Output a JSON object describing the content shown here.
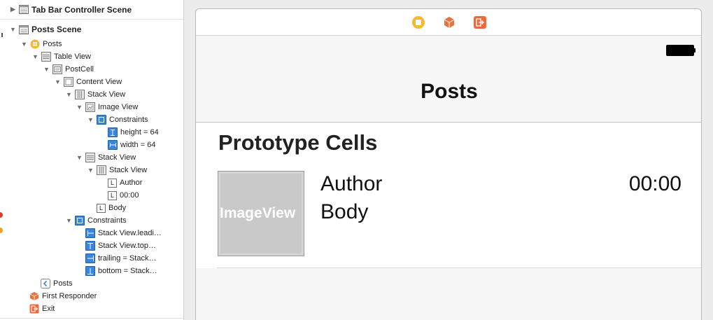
{
  "colors": {
    "accent_blue": "#3a86d8",
    "posts_yellow": "#f5b82e",
    "responder_orange": "#e8743b",
    "exit_orange": "#ef6a3a",
    "battery": "#000000"
  },
  "outline": {
    "tab_bar_scene": "Tab Bar Controller Scene",
    "posts_scene": "Posts Scene",
    "items": [
      {
        "label": "Posts",
        "icon": "view-controller-icon"
      },
      {
        "label": "Table View",
        "icon": "table-view-icon"
      },
      {
        "label": "PostCell",
        "icon": "table-cell-icon"
      },
      {
        "label": "Content View",
        "icon": "content-view-icon"
      },
      {
        "label": "Stack View",
        "icon": "horizontal-stack-icon"
      },
      {
        "label": "Image View",
        "icon": "image-view-icon"
      },
      {
        "label": "Constraints",
        "icon": "constraints-icon"
      },
      {
        "label": "height = 64",
        "icon": "height-constraint-icon"
      },
      {
        "label": "width = 64",
        "icon": "width-constraint-icon"
      },
      {
        "label": "Stack View",
        "icon": "vertical-stack-icon"
      },
      {
        "label": "Stack View",
        "icon": "horizontal-stack-icon"
      },
      {
        "label": "Author",
        "icon": "label-icon"
      },
      {
        "label": "00:00",
        "icon": "label-icon"
      },
      {
        "label": "Body",
        "icon": "label-icon"
      },
      {
        "label": "Constraints",
        "icon": "constraints-icon"
      },
      {
        "label": "Stack View.leadi…",
        "icon": "leading-constraint-icon"
      },
      {
        "label": "Stack View.top…",
        "icon": "top-constraint-icon"
      },
      {
        "label": "trailing = Stack…",
        "icon": "trailing-constraint-icon"
      },
      {
        "label": "bottom = Stack…",
        "icon": "bottom-constraint-icon"
      },
      {
        "label": "Posts",
        "icon": "navigation-item-icon"
      },
      {
        "label": "First Responder",
        "icon": "first-responder-icon"
      },
      {
        "label": "Exit",
        "icon": "exit-icon"
      }
    ]
  },
  "canvas": {
    "dock_icons": [
      "view-controller-icon",
      "first-responder-icon",
      "exit-icon"
    ],
    "nav_title": "Posts",
    "section_title": "Prototype Cells",
    "image_placeholder": "ImageView",
    "author": "Author",
    "body": "Body",
    "time": "00:00"
  }
}
